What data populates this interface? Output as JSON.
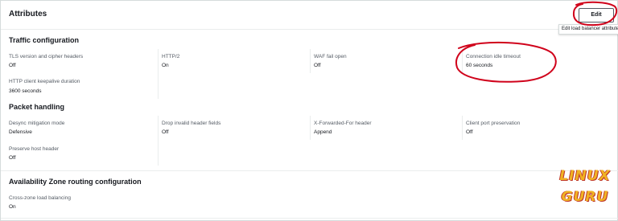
{
  "header": {
    "title": "Attributes",
    "edit_label": "Edit",
    "tooltip": "Edit load balancer attributes"
  },
  "traffic": {
    "title": "Traffic configuration",
    "fields": [
      {
        "label": "TLS version and cipher headers",
        "value": "Off"
      },
      {
        "label": "HTTP/2",
        "value": "On"
      },
      {
        "label": "WAF fail open",
        "value": "Off"
      },
      {
        "label": "Connection idle timeout",
        "value": "60 seconds"
      },
      {
        "label": "HTTP client keepalive duration",
        "value": "3600 seconds"
      }
    ]
  },
  "packet": {
    "title": "Packet handling",
    "fields": [
      {
        "label": "Desync mitigation mode",
        "value": "Defensive"
      },
      {
        "label": "Drop invalid header fields",
        "value": "Off"
      },
      {
        "label": "X-Forwarded-For header",
        "value": "Append"
      },
      {
        "label": "Client port preservation",
        "value": "Off"
      },
      {
        "label": "Preserve host header",
        "value": "Off"
      }
    ]
  },
  "az": {
    "title": "Availability Zone routing configuration",
    "fields": [
      {
        "label": "Cross-zone load balancing",
        "value": "On"
      }
    ]
  },
  "watermark": {
    "line1": "LINUX",
    "line2": "GURU"
  },
  "colors": {
    "annotation": "#d0021b",
    "logo_fill": "#f0b323",
    "logo_outline": "#c0392b"
  }
}
